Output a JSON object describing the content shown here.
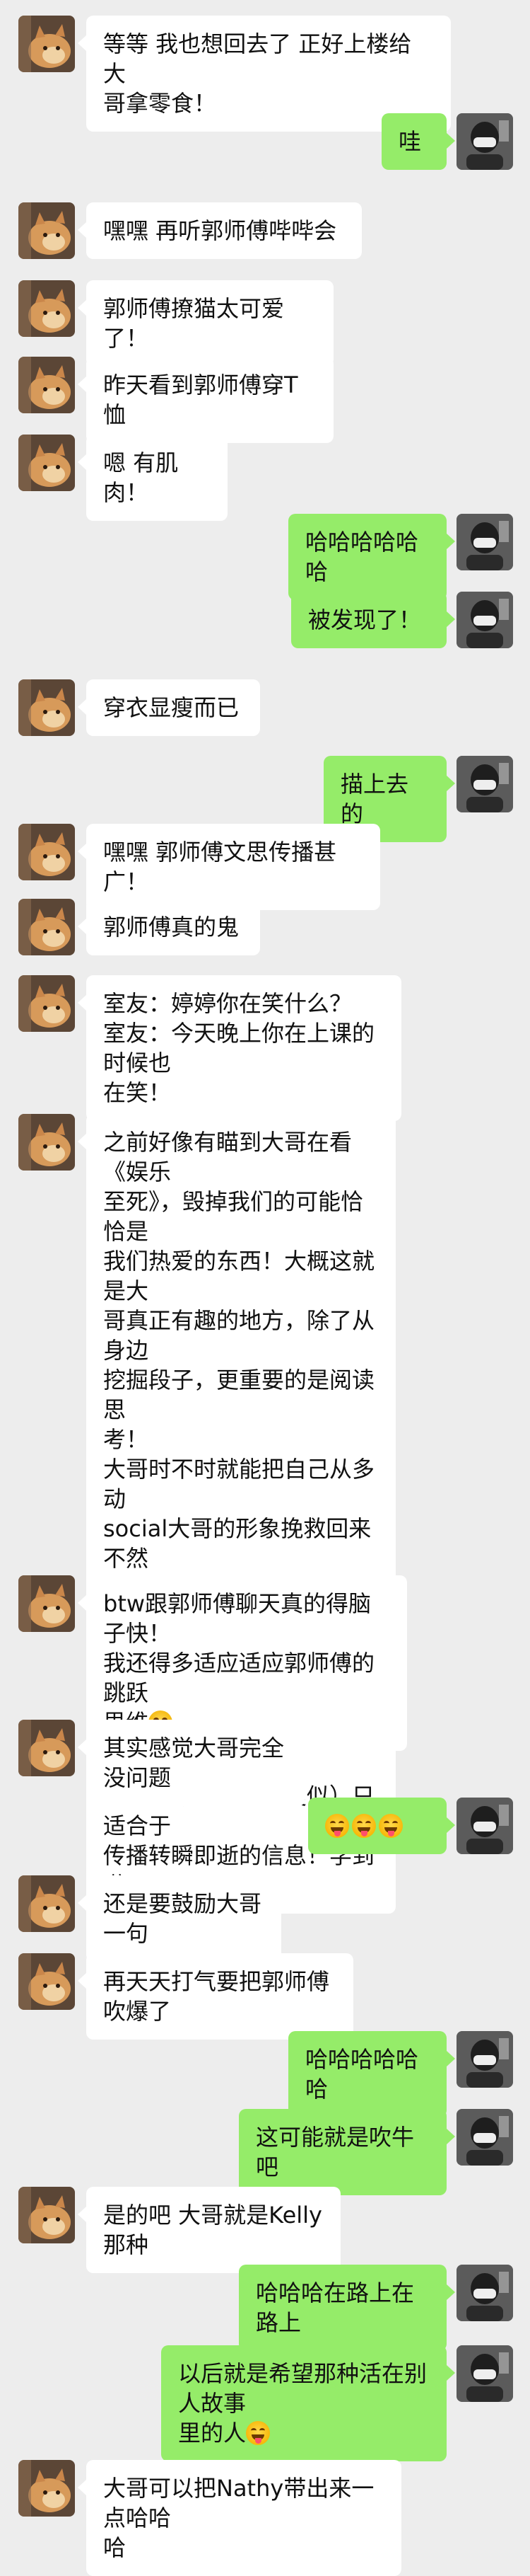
{
  "colors": {
    "background": "#ededed",
    "left_bubble": "#ffffff",
    "right_bubble": "#95ec69",
    "text": "#111111"
  },
  "avatars": {
    "left": "cat-avatar",
    "right": "person-avatar"
  },
  "messages": [
    {
      "side": "left",
      "text": "等等 我也想回去了 正好上楼给大\n哥拿零食！"
    },
    {
      "side": "right",
      "text": "哇"
    },
    {
      "side": "left",
      "text": "嘿嘿 再听郭师傅哔哔会"
    },
    {
      "side": "left",
      "text": "郭师傅撩猫太可爱了！"
    },
    {
      "side": "left",
      "text": "昨天看到郭师傅穿T恤"
    },
    {
      "side": "left",
      "text": "嗯 有肌肉！"
    },
    {
      "side": "right",
      "text": "哈哈哈哈哈哈"
    },
    {
      "side": "right",
      "text": "被发现了！"
    },
    {
      "side": "left",
      "text": "穿衣显瘦而已"
    },
    {
      "side": "right",
      "text": "描上去的"
    },
    {
      "side": "left",
      "text": "嘿嘿 郭师傅文思传播甚广！"
    },
    {
      "side": "left",
      "text": "郭师傅真的鬼"
    },
    {
      "side": "left",
      "text": "室友：婷婷你在笑什么？\n室友：今天晚上你在上课的时候也\n在笑！"
    },
    {
      "side": "left",
      "text": "之前好像有瞄到大哥在看《娱乐\n至死》，毁掉我们的可能恰恰是\n我们热爱的东西！大概这就是大\n哥真正有趣的地方，除了从身边\n挖掘段子，更重要的是阅读思\n考！\n大哥时不时就能把自己从多动\nsocial大哥的形象挽救回来 不然\n我可能只听你聊天，觉得郭师傅\n就是个逗逼了哈哈哈哈哈哈\n写作是作者试图使思想永恒并以\n此为人类对话做出贡献的一种努\n力！电报（网络也类似）只适合于\n传播转瞬即逝的信息！学到啦"
    },
    {
      "side": "left",
      "text": "btw跟郭师傅聊天真的得脑子快！\n我还得多适应适应郭师傅的跳跃\n思维",
      "emoji": "salute-face-emoji"
    },
    {
      "side": "left",
      "text": "其实感觉大哥完全没问题"
    },
    {
      "side": "right",
      "text": "",
      "emojis": [
        "tongue-face-emoji",
        "tongue-face-emoji",
        "tongue-face-emoji"
      ]
    },
    {
      "side": "left",
      "text": "还是要鼓励大哥一句"
    },
    {
      "side": "left",
      "text": "再天天打气要把郭师傅吹爆了"
    },
    {
      "side": "right",
      "text": "哈哈哈哈哈哈"
    },
    {
      "side": "right",
      "text": "这可能就是吹牛吧"
    },
    {
      "side": "left",
      "text": "是的吧 大哥就是Kelly那种"
    },
    {
      "side": "right",
      "text": "哈哈哈在路上在路上"
    },
    {
      "side": "right",
      "text": "以后就是希望那种活在别人故事\n里的人",
      "emoji": "tongue-face-emoji"
    },
    {
      "side": "left",
      "text": "大哥可以把Nathy带出来一点哈哈\n哈"
    }
  ]
}
